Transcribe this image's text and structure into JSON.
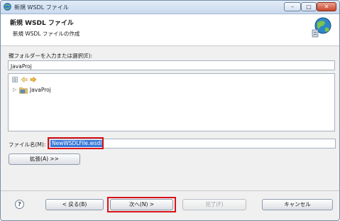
{
  "window": {
    "title": "新規 WSDL ファイル",
    "minimize": "–",
    "maximize": "□",
    "close": "✕"
  },
  "header": {
    "title": "新規 WSDL ファイル",
    "subtitle": "新規 WSDL ファイルの作成",
    "icon": "globe-wizard-icon"
  },
  "parent_folder": {
    "label": "親フォルダーを入力または選択(E):",
    "value": "JavaProj"
  },
  "tree": {
    "toolbar": [
      "home-icon",
      "back-arrow-icon",
      "forward-arrow-icon"
    ],
    "items": [
      {
        "label": "JavaProj",
        "icon": "project-folder-icon",
        "expander": "▷"
      }
    ]
  },
  "file_name": {
    "label": "ファイル名(M):",
    "value": "NewWSDLFile.wsdl"
  },
  "advanced_button": "拡張(A) >>",
  "footer": {
    "help": "?",
    "back": "< 戻る(B)",
    "next": "次へ(N) >",
    "finish": "完了(F)",
    "cancel": "キャンセル"
  },
  "colors": {
    "highlight": "#d8141a",
    "selection": "#3a79d7"
  }
}
